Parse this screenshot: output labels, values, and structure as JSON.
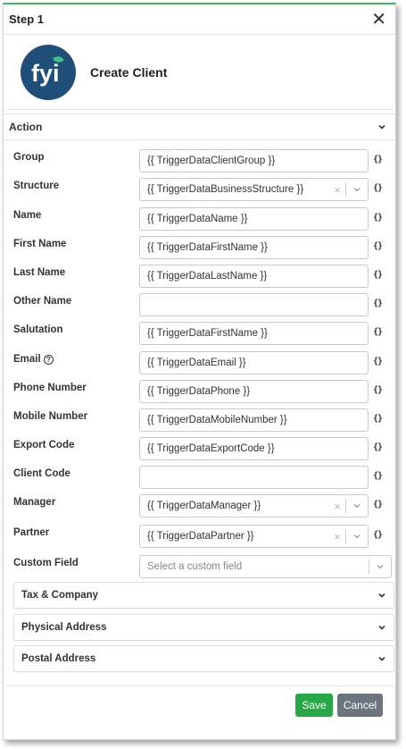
{
  "step": {
    "title": "Step 1",
    "close_glyph": "✕"
  },
  "client": {
    "title": "Create Client",
    "logo_text": "fyi"
  },
  "action_section": {
    "title": "Action"
  },
  "fields": [
    {
      "label": "Group",
      "value": "{{ TriggerDataClientGroup }}",
      "kind": "text"
    },
    {
      "label": "Structure",
      "value": "{{ TriggerDataBusinessStructure }}",
      "kind": "select"
    },
    {
      "label": "Name",
      "value": "{{ TriggerDataName }}",
      "kind": "text"
    },
    {
      "label": "First Name",
      "value": "{{ TriggerDataFirstName }}",
      "kind": "text"
    },
    {
      "label": "Last Name",
      "value": "{{ TriggerDataLastName }}",
      "kind": "text"
    },
    {
      "label": "Other Name",
      "value": "",
      "kind": "text"
    },
    {
      "label": "Salutation",
      "value": "{{ TriggerDataFirstName }}",
      "kind": "text"
    },
    {
      "label": "Email",
      "value": "{{ TriggerDataEmail }}",
      "kind": "text",
      "help": true
    },
    {
      "label": "Phone Number",
      "value": "{{ TriggerDataPhone }}",
      "kind": "text"
    },
    {
      "label": "Mobile Number",
      "value": "{{ TriggerDataMobileNumber }}",
      "kind": "text"
    },
    {
      "label": "Export Code",
      "value": "{{ TriggerDataExportCode }}",
      "kind": "text"
    },
    {
      "label": "Client Code",
      "value": "",
      "kind": "text"
    },
    {
      "label": "Manager",
      "value": "{{ TriggerDataManager }}",
      "kind": "select"
    },
    {
      "label": "Partner",
      "value": "{{ TriggerDataPartner }}",
      "kind": "select"
    }
  ],
  "custom_field": {
    "label": "Custom Field",
    "placeholder": "Select a custom field"
  },
  "braces_glyph": "{}",
  "clear_glyph": "×",
  "help_glyph": "?",
  "sections": [
    {
      "title": "Tax & Company"
    },
    {
      "title": "Physical Address"
    },
    {
      "title": "Postal Address"
    }
  ],
  "buttons": {
    "save": "Save",
    "cancel": "Cancel"
  },
  "colors": {
    "accent": "#3fb65f",
    "save": "#28a745",
    "cancel": "#6c757d",
    "logo_bg": "#1f4e79"
  }
}
